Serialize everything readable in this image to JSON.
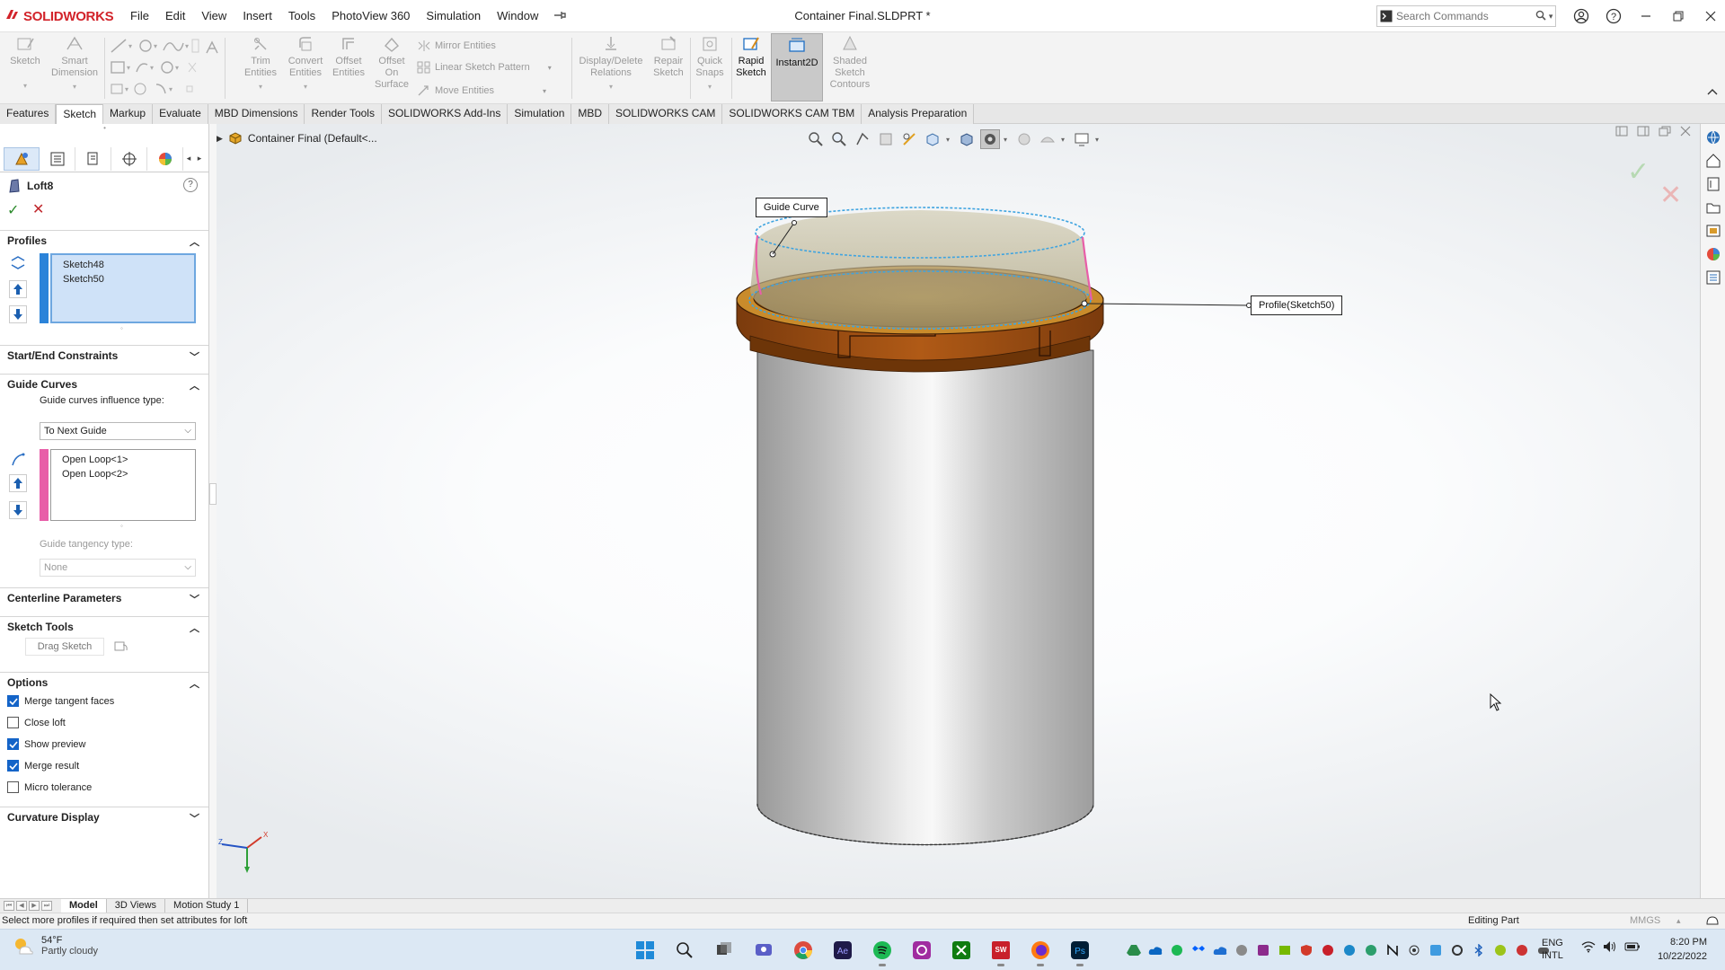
{
  "app": {
    "brand": "SOLIDWORKS",
    "document_title": "Container Final.SLDPRT *",
    "colors": {
      "brand_red": "#d2232a",
      "accent_blue": "#1464c8",
      "guide_pink": "#e85ea8",
      "profile_blue": "#4aa8e0",
      "part_orange": "#a24f12",
      "body_gray": "#b6b6b6"
    }
  },
  "menu": {
    "items": [
      "File",
      "Edit",
      "View",
      "Insert",
      "Tools",
      "PhotoView 360",
      "Simulation",
      "Window"
    ]
  },
  "search": {
    "placeholder": "Search Commands"
  },
  "command_manager": {
    "sketch": "Sketch",
    "smart_dimension_1": "Smart",
    "smart_dimension_2": "Dimension",
    "trim_1": "Trim",
    "trim_2": "Entities",
    "convert_1": "Convert",
    "convert_2": "Entities",
    "offset_1": "Offset",
    "offset_2": "Entities",
    "offset_surface_1": "Offset",
    "offset_surface_2": "On",
    "offset_surface_3": "Surface",
    "mirror": "Mirror Entities",
    "linear_pattern": "Linear Sketch Pattern",
    "move": "Move Entities",
    "relations_1": "Display/Delete",
    "relations_2": "Relations",
    "repair_1": "Repair",
    "repair_2": "Sketch",
    "snaps_1": "Quick",
    "snaps_2": "Snaps",
    "rapid_1": "Rapid",
    "rapid_2": "Sketch",
    "instant2d": "Instant2D",
    "shaded_1": "Shaded",
    "shaded_2": "Sketch",
    "shaded_3": "Contours"
  },
  "tabs": [
    "Features",
    "Sketch",
    "Markup",
    "Evaluate",
    "MBD Dimensions",
    "Render Tools",
    "SOLIDWORKS Add-Ins",
    "Simulation",
    "MBD",
    "SOLIDWORKS CAM",
    "SOLIDWORKS CAM TBM",
    "Analysis Preparation"
  ],
  "active_tab": "Sketch",
  "property_manager": {
    "title": "Loft8",
    "help": "?",
    "profiles": {
      "header": "Profiles",
      "items": [
        "Sketch48",
        "Sketch50"
      ]
    },
    "start_end": {
      "header": "Start/End Constraints"
    },
    "guide_curves": {
      "header": "Guide Curves",
      "influence_label": "Guide curves influence type:",
      "influence_value": "To Next Guide",
      "items": [
        "Open Loop<1>",
        "Open Loop<2>"
      ],
      "tangency_label": "Guide tangency type:",
      "tangency_value": "None"
    },
    "centerline": {
      "header": "Centerline Parameters"
    },
    "sketch_tools": {
      "header": "Sketch Tools",
      "drag_sketch": "Drag Sketch"
    },
    "options": {
      "header": "Options",
      "checks": [
        {
          "label": "Merge tangent faces",
          "checked": true
        },
        {
          "label": "Close loft",
          "checked": false
        },
        {
          "label": "Show preview",
          "checked": true
        },
        {
          "label": "Merge result",
          "checked": true
        },
        {
          "label": "Micro tolerance",
          "checked": false
        }
      ]
    },
    "curvature": {
      "header": "Curvature Display"
    }
  },
  "viewport": {
    "tree_label": "Container Final  (Default<...",
    "callouts": {
      "guide": "Guide Curve",
      "profile": "Profile(Sketch50)"
    },
    "triad": {
      "x": "X",
      "y": "Y",
      "z": "Z"
    }
  },
  "bottom_tabs": [
    "Model",
    "3D Views",
    "Motion Study 1"
  ],
  "status": {
    "message": "Select more profiles if required then set attributes for loft",
    "mode": "Editing Part",
    "units": "MMGS"
  },
  "taskbar": {
    "weather_temp": "54°F",
    "weather_desc": "Partly cloudy",
    "lang_1": "ENG",
    "lang_2": "INTL",
    "time": "8:20 PM",
    "date": "10/22/2022"
  }
}
